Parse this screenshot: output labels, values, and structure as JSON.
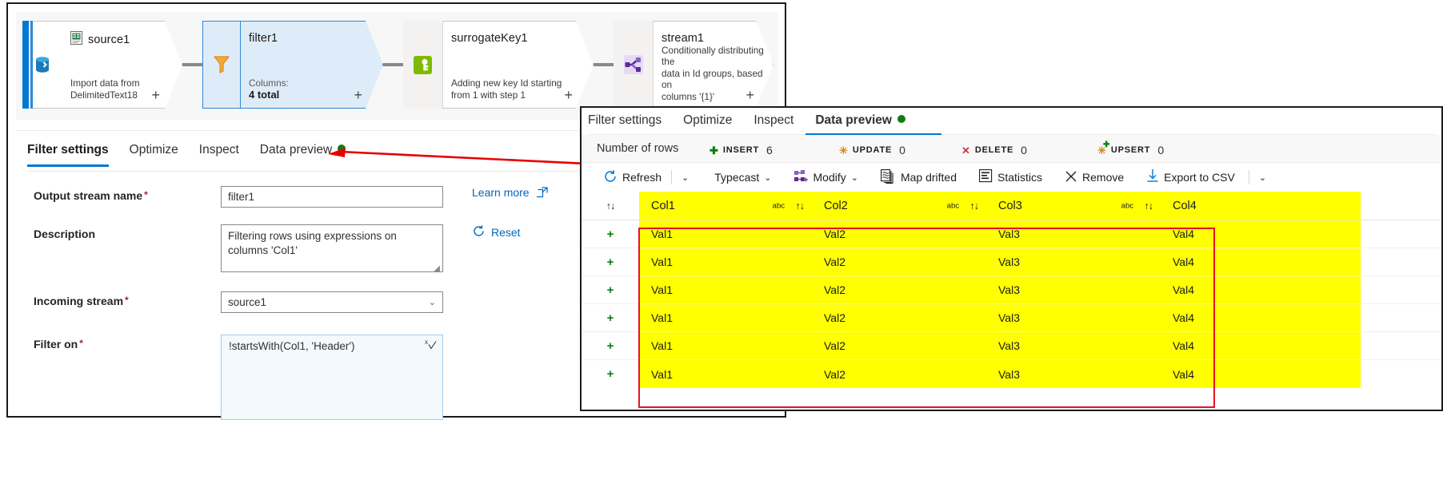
{
  "flow": {
    "nodes": [
      {
        "name": "source1",
        "icon": "csv-file-icon",
        "badge_icon": "dataset-import-icon",
        "desc": "Import data from\nDelimitedText18",
        "sub_label": "",
        "sub_value": "",
        "plus": "+"
      },
      {
        "name": "filter1",
        "icon": "filter-funnel-icon",
        "badge_icon": "filter-funnel-icon",
        "desc": "",
        "sub_label": "Columns:",
        "sub_value": "4 total",
        "plus": "+"
      },
      {
        "name": "surrogateKey1",
        "icon": "key-icon",
        "badge_icon": "key-icon",
        "desc": "Adding new key Id starting\nfrom 1 with step 1",
        "sub_label": "",
        "sub_value": "",
        "plus": "+"
      },
      {
        "name": "stream1",
        "icon": "conditional-split-icon",
        "badge_icon": "conditional-split-icon",
        "desc": "Conditionally distributing the\ndata in Id groups, based on\ncolumns '{1}'",
        "sub_label": "",
        "sub_value": "",
        "plus": "+"
      }
    ]
  },
  "settings_panel": {
    "tabs": [
      {
        "label": "Filter settings",
        "active": true,
        "dot": false
      },
      {
        "label": "Optimize",
        "active": false,
        "dot": false
      },
      {
        "label": "Inspect",
        "active": false,
        "dot": false
      },
      {
        "label": "Data preview",
        "active": false,
        "dot": true
      }
    ],
    "fields": {
      "output_stream_name": {
        "label": "Output stream name",
        "required": "*",
        "value": "filter1"
      },
      "description": {
        "label": "Description",
        "required": "",
        "value": "Filtering rows using expressions on columns 'Col1'"
      },
      "incoming_stream": {
        "label": "Incoming stream",
        "required": "*",
        "value": "source1",
        "caret": "chevron-down-icon"
      },
      "filter_on": {
        "label": "Filter on",
        "required": "*",
        "value": "!startsWith(Col1, 'Header')",
        "expression_icon": "expression-editor-icon"
      }
    },
    "links": {
      "learn_more": "Learn more",
      "learn_more_icon": "open-in-new-icon",
      "reset": "Reset",
      "reset_icon": "refresh-circle-icon"
    }
  },
  "preview_window": {
    "tabs": [
      {
        "label": "Filter settings",
        "active": false,
        "dot": false
      },
      {
        "label": "Optimize",
        "active": false,
        "dot": false
      },
      {
        "label": "Inspect",
        "active": false,
        "dot": false
      },
      {
        "label": "Data preview",
        "active": true,
        "dot": true
      }
    ],
    "row_counts": {
      "label": "Number of rows",
      "stats": [
        {
          "key": "INSERT",
          "value": "6",
          "symbol": "+",
          "color": "#107c10",
          "icon": "insert-plus-icon"
        },
        {
          "key": "UPDATE",
          "value": "0",
          "symbol": "✳",
          "color": "#d38b2a",
          "icon": "update-asterisk-icon"
        },
        {
          "key": "DELETE",
          "value": "0",
          "symbol": "✕",
          "color": "#d13438",
          "icon": "delete-x-icon"
        },
        {
          "key": "UPSERT",
          "value": "0",
          "symbol": "✳",
          "color": "#d38b2a",
          "icon": "upsert-asterisk-plus-icon"
        }
      ]
    },
    "toolbar": [
      {
        "label": "Refresh",
        "icon": "refresh-icon",
        "has_caret": true
      },
      {
        "label": "Typecast",
        "icon": "",
        "has_caret": true
      },
      {
        "label": "Modify",
        "icon": "modify-icon",
        "has_caret": true
      },
      {
        "label": "Map drifted",
        "icon": "map-drifted-icon",
        "has_caret": false
      },
      {
        "label": "Statistics",
        "icon": "statistics-icon",
        "has_caret": false
      },
      {
        "label": "Remove",
        "icon": "remove-x-icon",
        "has_caret": false
      },
      {
        "label": "Export to CSV",
        "icon": "download-icon",
        "has_caret": false
      }
    ],
    "toolbar_overflow_icon": "chevron-down-icon",
    "grid": {
      "columns": [
        "Col1",
        "Col2",
        "Col3",
        "Col4"
      ],
      "column_type_badge": "abc",
      "sort_icon": "sort-updown-icon",
      "row_marker": "+",
      "rows": [
        [
          "Val1",
          "Val2",
          "Val3",
          "Val4"
        ],
        [
          "Val1",
          "Val2",
          "Val3",
          "Val4"
        ],
        [
          "Val1",
          "Val2",
          "Val3",
          "Val4"
        ],
        [
          "Val1",
          "Val2",
          "Val3",
          "Val4"
        ],
        [
          "Val1",
          "Val2",
          "Val3",
          "Val4"
        ],
        [
          "Val1",
          "Val2",
          "Val3",
          "Val4"
        ]
      ]
    }
  },
  "annotations": {
    "arrow_color": "#e60000",
    "highlight_border_color": "#e81123",
    "highlight_fill_color": "#ffff00"
  }
}
